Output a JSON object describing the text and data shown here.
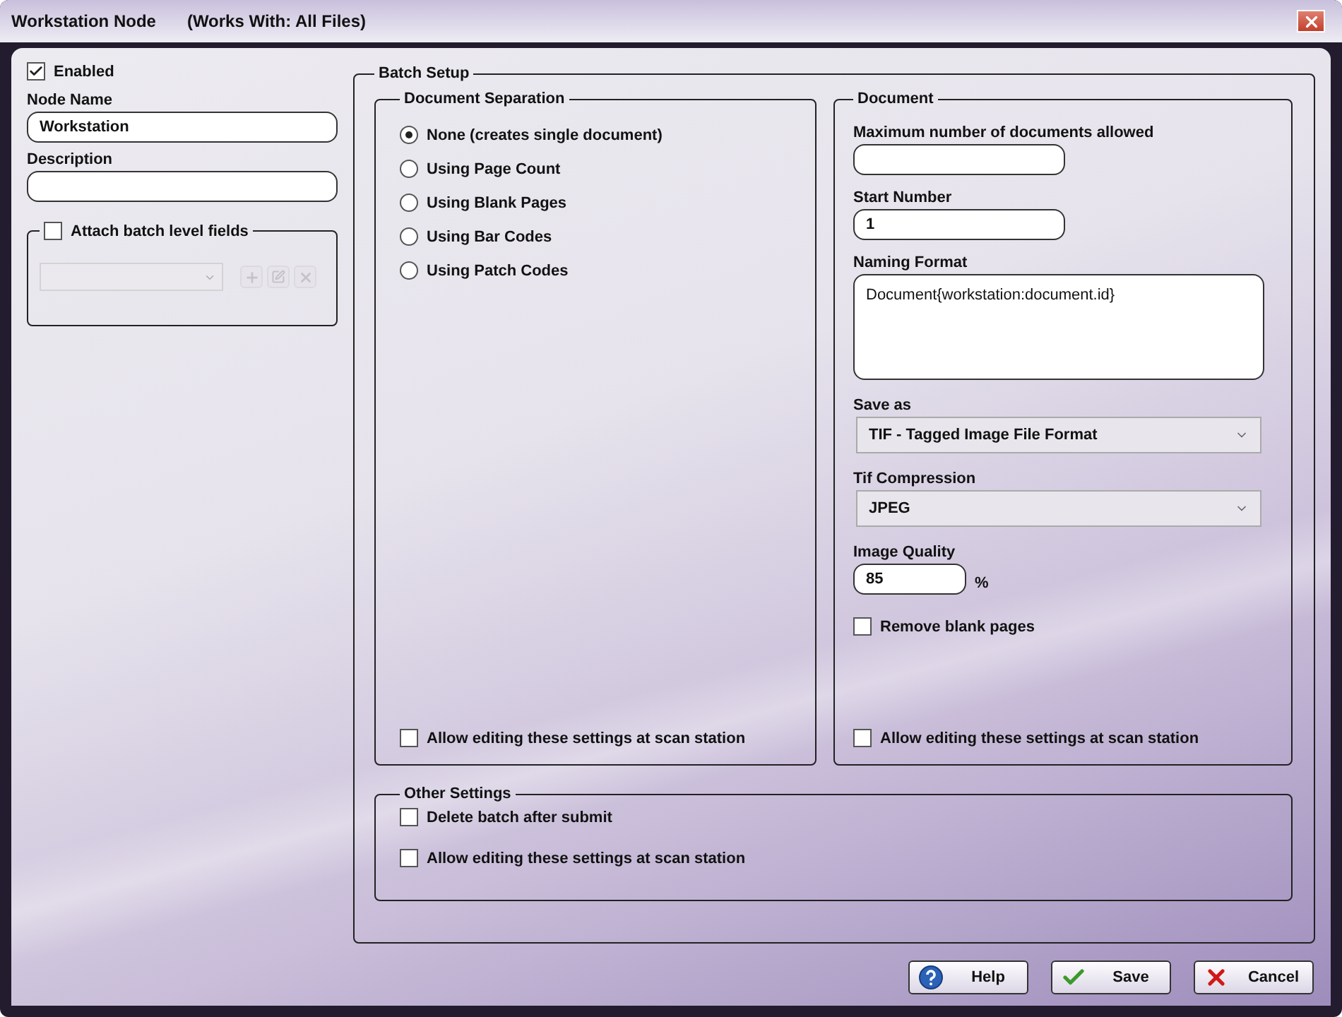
{
  "window": {
    "title": "Workstation Node",
    "subtitle": "(Works With: All Files)"
  },
  "general": {
    "enabled": {
      "label": "Enabled",
      "checked": true
    },
    "fields": [
      {
        "label": "Node Name",
        "value": "Workstation"
      },
      {
        "label": "Description"
      }
    ],
    "batch_fields": {
      "label": "Attach batch level fields",
      "checked": false,
      "disabled": true
    }
  },
  "batch_setup": {
    "title": "Batch Setup",
    "separation": {
      "title": "Document Separation",
      "options": [
        {
          "label": "None (creates single document)",
          "selected": true
        },
        {
          "label": "Using Page Count",
          "selected": false
        },
        {
          "label": "Using Blank Pages",
          "selected": false
        },
        {
          "label": "Using Bar Codes",
          "selected": false
        },
        {
          "label": "Using Patch Codes",
          "selected": false
        }
      ],
      "allow_edit": {
        "label": "Allow editing these settings at scan station",
        "checked": false
      }
    },
    "document": {
      "title": "Document",
      "items": [
        {
          "kind": "text",
          "label": "Maximum number of documents allowed"
        },
        {
          "kind": "text",
          "label": "Start Number",
          "value": "1"
        },
        {
          "kind": "textarea",
          "label": "Naming Format",
          "value": "Document{workstation:document.id}"
        },
        {
          "kind": "select",
          "label": "Save as",
          "value": "TIF - Tagged Image File Format"
        },
        {
          "kind": "select",
          "label": "Tif Compression",
          "value": "JPEG"
        },
        {
          "kind": "percent",
          "label": "Image Quality",
          "value": "85",
          "unit": "%"
        },
        {
          "kind": "checkbox",
          "label": "Remove blank pages",
          "checked": false
        }
      ],
      "allow_edit": {
        "label": "Allow editing these settings at scan station",
        "checked": false
      }
    },
    "other_settings": {
      "title": "Other Settings",
      "options": [
        {
          "label": "Delete batch after submit",
          "checked": false
        },
        {
          "label": "Allow editing these settings at scan station",
          "checked": false
        }
      ]
    }
  },
  "buttons": [
    {
      "kind": "help",
      "label": "Help"
    },
    {
      "kind": "save",
      "label": "Save"
    },
    {
      "kind": "cancel",
      "label": "Cancel"
    }
  ]
}
